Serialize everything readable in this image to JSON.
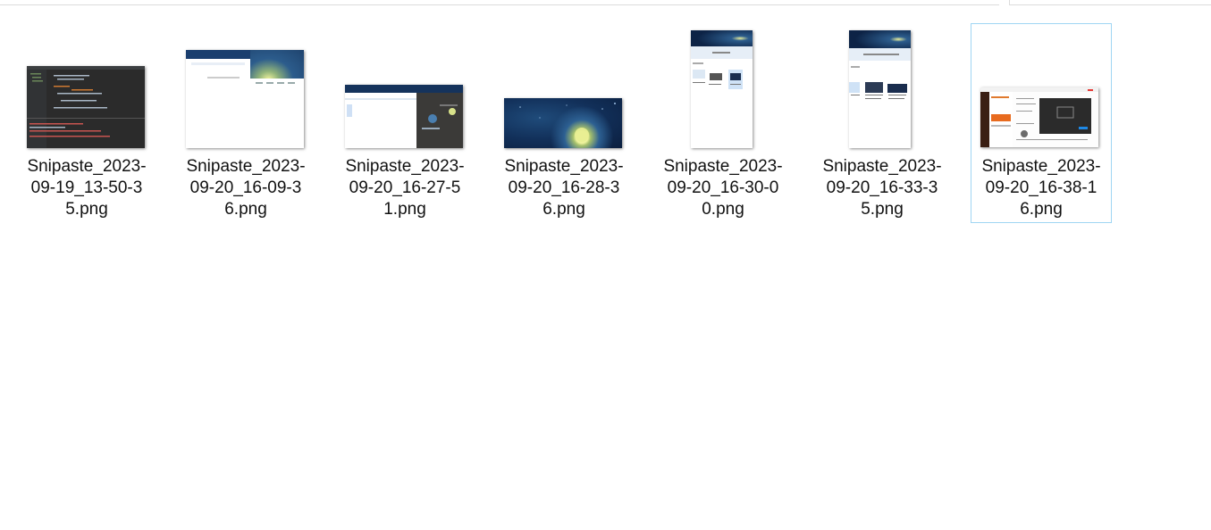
{
  "files": [
    {
      "name_line1": "Snipaste_2023-",
      "name_line2": "09-19_13-50-3",
      "name_line3": "5.png",
      "thumb": "code-editor-screenshot"
    },
    {
      "name_line1": "Snipaste_2023-",
      "name_line2": "09-20_16-09-3",
      "name_line3": "6.png",
      "thumb": "browser-starry-screenshot"
    },
    {
      "name_line1": "Snipaste_2023-",
      "name_line2": "09-20_16-27-5",
      "name_line3": "1.png",
      "thumb": "window-dark-screenshot"
    },
    {
      "name_line1": "Snipaste_2023-",
      "name_line2": "09-20_16-28-3",
      "name_line3": "6.png",
      "thumb": "starry-night-screenshot"
    },
    {
      "name_line1": "Snipaste_2023-",
      "name_line2": "09-20_16-30-0",
      "name_line3": "0.png",
      "thumb": "explorer-narrow-screenshot"
    },
    {
      "name_line1": "Snipaste_2023-",
      "name_line2": "09-20_16-33-3",
      "name_line3": "5.png",
      "thumb": "explorer-narrow-screenshot-2"
    },
    {
      "name_line1": "Snipaste_2023-",
      "name_line2": "09-20_16-38-1",
      "name_line3": "6.png",
      "thumb": "web-dialog-screenshot",
      "selected": true
    }
  ],
  "colors": {
    "selection_border": "#9fd5f3",
    "text": "#111111",
    "background": "#ffffff"
  }
}
